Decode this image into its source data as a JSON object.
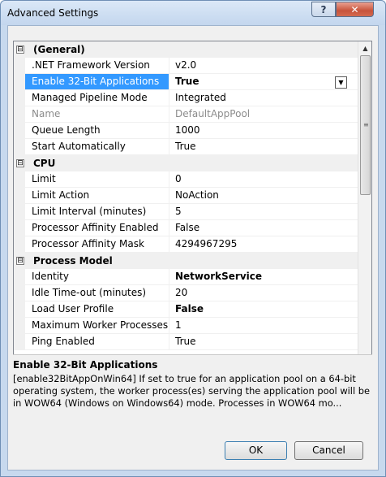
{
  "window": {
    "title": "Advanced Settings",
    "help_glyph": "?",
    "close_glyph": "✕"
  },
  "grid": {
    "expander_glyph": "⊟",
    "categories": [
      {
        "label": "(General)",
        "rows": [
          {
            "name": ".NET Framework Version",
            "value": "v2.0"
          },
          {
            "name": "Enable 32-Bit Applications",
            "value": "True",
            "selected": true,
            "bold": true,
            "dropdown": "▼"
          },
          {
            "name": "Managed Pipeline Mode",
            "value": "Integrated"
          },
          {
            "name": "Name",
            "value": "DefaultAppPool",
            "gray": true
          },
          {
            "name": "Queue Length",
            "value": "1000"
          },
          {
            "name": "Start Automatically",
            "value": "True"
          }
        ]
      },
      {
        "label": "CPU",
        "rows": [
          {
            "name": "Limit",
            "value": "0"
          },
          {
            "name": "Limit Action",
            "value": "NoAction"
          },
          {
            "name": "Limit Interval (minutes)",
            "value": "5"
          },
          {
            "name": "Processor Affinity Enabled",
            "value": "False"
          },
          {
            "name": "Processor Affinity Mask",
            "value": "4294967295"
          }
        ]
      },
      {
        "label": "Process Model",
        "rows": [
          {
            "name": "Identity",
            "value": "NetworkService",
            "bold": true
          },
          {
            "name": "Idle Time-out (minutes)",
            "value": "20"
          },
          {
            "name": "Load User Profile",
            "value": "False",
            "bold": true
          },
          {
            "name": "Maximum Worker Processes",
            "value": "1"
          },
          {
            "name": "Ping Enabled",
            "value": "True"
          }
        ]
      }
    ]
  },
  "scrollbar": {
    "up": "▲",
    "down": "▼",
    "grip": "≡"
  },
  "description": {
    "title": "Enable 32-Bit Applications",
    "text": "[enable32BitAppOnWin64] If set to true for an application pool on a 64-bit operating system, the worker process(es) serving the application pool will be in WOW64 (Windows on Windows64) mode. Processes in WOW64 mo..."
  },
  "buttons": {
    "ok": "OK",
    "cancel": "Cancel"
  }
}
